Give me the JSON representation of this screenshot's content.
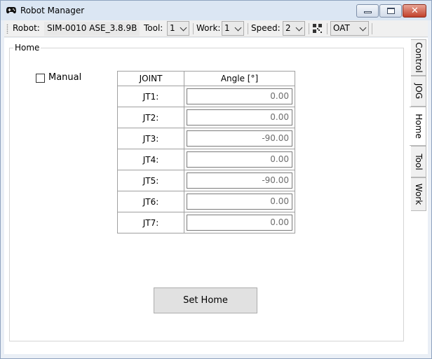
{
  "window": {
    "title": "Robot Manager",
    "icons": {
      "app": "gamepad-icon",
      "minimize": "minimize-icon",
      "maximize": "maximize-icon",
      "close": "close-icon"
    },
    "close_glyph": "✕"
  },
  "toolbar": {
    "robot_label": "Robot:",
    "robot_id": "SIM-0010 ASE_3.8.9B",
    "tool_label": "Tool:",
    "tool_value": "1",
    "work_label": "Work:",
    "work_value": "1",
    "speed_label": "Speed:",
    "speed_value": "2",
    "qr_icon": "qr-code-icon",
    "mode_value": "OAT"
  },
  "home": {
    "group_title": "Home",
    "manual_label": "Manual",
    "manual_checked": false,
    "table": {
      "col_joint": "JOINT",
      "col_angle": "Angle [°]",
      "rows": [
        {
          "joint": "JT1:",
          "angle": "0.00"
        },
        {
          "joint": "JT2:",
          "angle": "0.00"
        },
        {
          "joint": "JT3:",
          "angle": "-90.00"
        },
        {
          "joint": "JT4:",
          "angle": "0.00"
        },
        {
          "joint": "JT5:",
          "angle": "-90.00"
        },
        {
          "joint": "JT6:",
          "angle": "0.00"
        },
        {
          "joint": "JT7:",
          "angle": "0.00"
        }
      ]
    },
    "set_home_label": "Set Home"
  },
  "tabs": [
    {
      "label": "Control",
      "active": false
    },
    {
      "label": "JOG",
      "active": false
    },
    {
      "label": "Home",
      "active": true
    },
    {
      "label": "Tool",
      "active": false
    },
    {
      "label": "Work",
      "active": false
    }
  ]
}
